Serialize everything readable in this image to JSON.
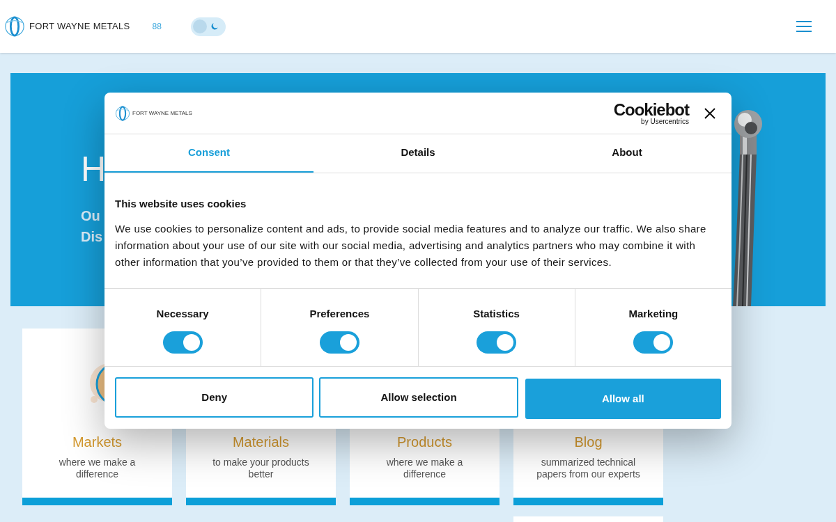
{
  "header": {
    "logo_text": "FORT WAYNE METALS",
    "indicator": "88",
    "theme_toggle": {
      "on": false
    }
  },
  "hero": {
    "heading": "H",
    "subtitle_lines": [
      "Ou",
      "Dis"
    ]
  },
  "cards": [
    {
      "title": "Markets",
      "text": "where we make a difference",
      "kind": "picture"
    },
    {
      "title": "Materials",
      "text": "to make your products better"
    },
    {
      "title": "Products",
      "text": "where we make a difference"
    },
    {
      "title": "Blog",
      "text": "summarized technical papers from our experts"
    }
  ],
  "cookie_dialog": {
    "logo_text": "FORT WAYNE METALS",
    "brand": "Cookiebot",
    "brand_sub": "by Usercentrics",
    "tabs": [
      {
        "label": "Consent",
        "selected": true
      },
      {
        "label": "Details",
        "selected": false
      },
      {
        "label": "About",
        "selected": false
      }
    ],
    "title": "This website uses cookies",
    "text": "We use cookies to personalize content and ads, to provide social media features and to analyze our traffic. We also share information about your use of our site with our social media, advertising and analytics partners who may combine it with other information that you’ve provided to them or that they’ve collected from your use of their services.",
    "categories": [
      {
        "label": "Necessary",
        "on": true
      },
      {
        "label": "Preferences",
        "on": true
      },
      {
        "label": "Statistics",
        "on": true
      },
      {
        "label": "Marketing",
        "on": true
      }
    ],
    "buttons": [
      {
        "label": "Deny",
        "kind": "outline"
      },
      {
        "label": "Allow selection",
        "kind": "outline"
      },
      {
        "label": "Allow all",
        "kind": "primary"
      }
    ]
  }
}
